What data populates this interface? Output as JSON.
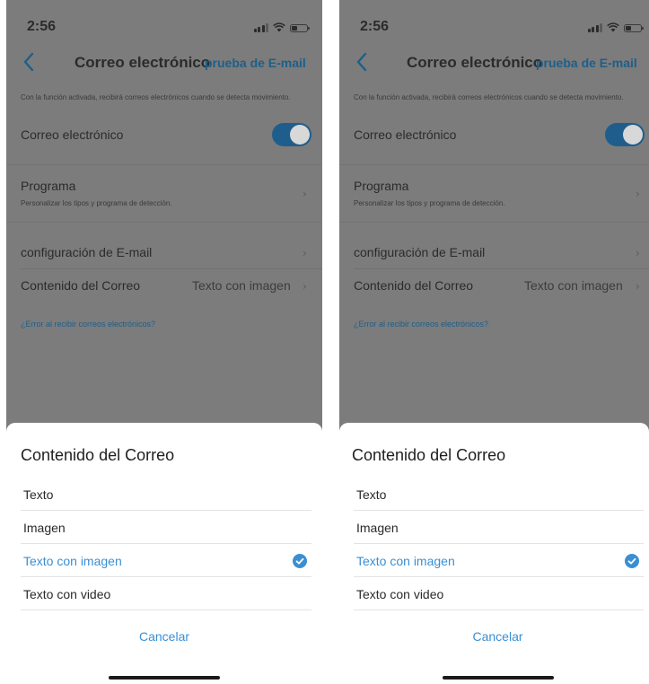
{
  "screens": [
    {
      "status": {
        "time": "2:56"
      },
      "nav": {
        "title": "Correo electrónico",
        "action": "prueba de E-mail"
      },
      "settings": {
        "hint": "Con la función activada, recibirá correos electrónicos cuando se detecta movimiento.",
        "email_toggle_label": "Correo electrónico",
        "email_toggle_on": true,
        "schedule_title": "Programa",
        "schedule_subtitle": "Personalizar los tipos y programa de detección.",
        "email_config_label": "configuración de E-mail",
        "content_label": "Contenido del Correo",
        "content_value": "Texto con imagen",
        "help_link": "¿Error al recibir correos electrónicos?"
      },
      "sheet": {
        "title": "Contenido del Correo",
        "options": [
          "Texto",
          "Imagen",
          "Texto con imagen",
          "Texto con video"
        ],
        "selected": "Texto con imagen",
        "cancel": "Cancelar"
      }
    },
    {
      "status": {
        "time": "2:56"
      },
      "nav": {
        "title": "Correo electrónico",
        "action": "prueba de E-mail"
      },
      "settings": {
        "hint": "Con la función activada, recibirá correos electrónicos cuando se detecta movimiento.",
        "email_toggle_label": "Correo electrónico",
        "email_toggle_on": true,
        "schedule_title": "Programa",
        "schedule_subtitle": "Personalizar los tipos y programa de detección.",
        "email_config_label": "configuración de E-mail",
        "content_label": "Contenido del Correo",
        "content_value": "Texto con imagen",
        "help_link": "¿Error al recibir correos electrónicos?"
      },
      "sheet": {
        "title": "Contenido del Correo",
        "options": [
          "Texto",
          "Imagen",
          "Texto con imagen",
          "Texto con video"
        ],
        "selected": "Texto con imagen",
        "cancel": "Cancelar"
      }
    }
  ],
  "colors": {
    "accent": "#3a8fd3",
    "accent_dimmed": "#1d5f8a",
    "overlay_background": "#7c7c7c",
    "sheet_background": "#ffffff"
  },
  "icons": {
    "back": "chevron-left-icon",
    "signal": "cellular-signal-icon",
    "wifi": "wifi-icon",
    "battery": "battery-icon",
    "row_arrow": "chevron-right-icon",
    "selected": "checkmark-circle-icon"
  }
}
